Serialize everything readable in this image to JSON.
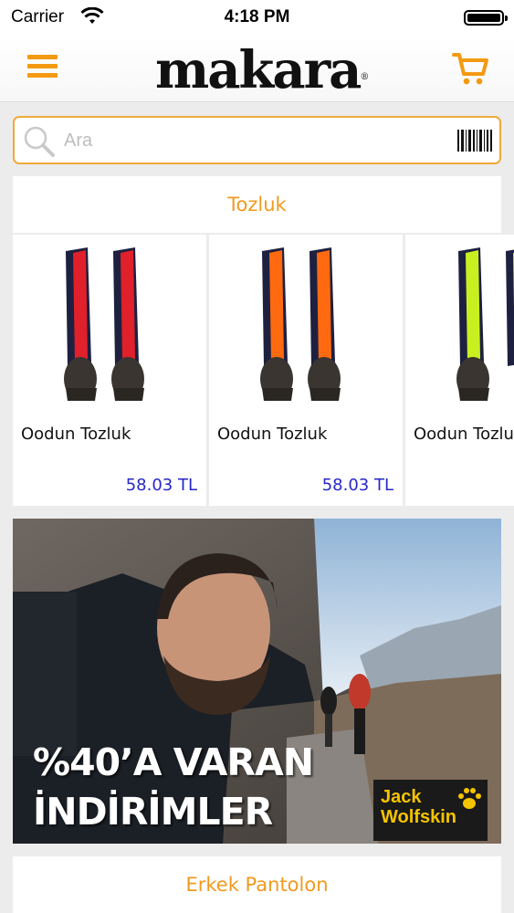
{
  "status_bar": {
    "carrier": "Carrier",
    "time": "4:18 PM"
  },
  "header": {
    "logo": "makara",
    "logo_mark": "®"
  },
  "search": {
    "placeholder": "Ara"
  },
  "sections": [
    {
      "title": "Tozluk",
      "products": [
        {
          "name": "Oodun Tozluk",
          "price": "58.03 TL",
          "color": "red"
        },
        {
          "name": "Oodun Tozluk",
          "price": "58.03 TL",
          "color": "orange"
        },
        {
          "name": "Oodun Tozluk",
          "color": "lime"
        }
      ]
    },
    {
      "title": "Erkek Pantolon"
    }
  ],
  "banner": {
    "line1": "%40’A VARAN",
    "line2": "İNDİRİMLER",
    "brand_line1": "Jack",
    "brand_line2": "Wolfskin"
  },
  "colors": {
    "accent": "#f39a12",
    "price": "#2727c9",
    "product_colors": {
      "red": "#e0202a",
      "orange": "#ff6a10",
      "lime": "#c8f020"
    }
  }
}
